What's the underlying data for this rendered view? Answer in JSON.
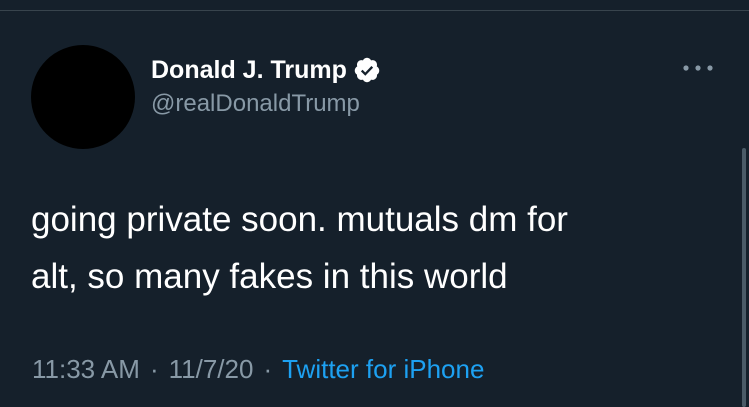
{
  "tweet": {
    "display_name": "Donald J. Trump",
    "handle": "@realDonaldTrump",
    "text": "going private soon. mutuals dm for\nalt, so many fakes in this world",
    "time": "11:33 AM",
    "separator": "·",
    "date": "11/7/20",
    "source": "Twitter for iPhone"
  },
  "icons": {
    "verified": "verified-badge-icon",
    "more": "more-options-icon"
  },
  "colors": {
    "background": "#15202b",
    "secondary_text": "#8899a6",
    "link": "#1da1f2",
    "avatar": "#000000"
  }
}
